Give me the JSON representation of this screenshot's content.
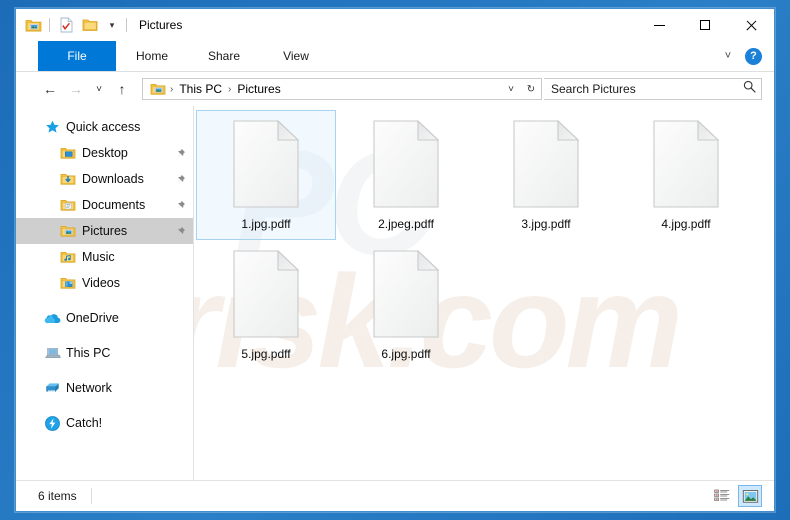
{
  "window": {
    "title": "Pictures",
    "quick_access_toolbar": [
      {
        "name": "pictures-folder-icon",
        "label": "Pictures properties"
      },
      {
        "name": "properties-icon",
        "label": "Properties"
      },
      {
        "name": "new-folder-icon",
        "label": "New folder"
      },
      {
        "name": "customize-qat-caret",
        "label": "▾"
      }
    ],
    "controls": {
      "minimize": "Minimize",
      "maximize": "Maximize",
      "close": "Close"
    }
  },
  "ribbon": {
    "tabs": [
      {
        "label": "File",
        "active": true
      },
      {
        "label": "Home",
        "active": false
      },
      {
        "label": "Share",
        "active": false
      },
      {
        "label": "View",
        "active": false
      }
    ],
    "expand_caret": "⌄",
    "help_label": "?"
  },
  "navigation": {
    "back": "←",
    "forward": "→",
    "recent": "⌄",
    "up": "↑",
    "breadcrumb": [
      "This PC",
      "Pictures"
    ],
    "breadcrumb_separator": "›",
    "dropdown_caret": "⌄",
    "refresh": "↻"
  },
  "search": {
    "placeholder": "Search Pictures",
    "value": "",
    "icon": "search-icon"
  },
  "sidebar": {
    "items": [
      {
        "label": "Quick access",
        "icon": "star-icon",
        "level": 0,
        "pinned": false,
        "selected": false
      },
      {
        "label": "Desktop",
        "icon": "desktop-folder-icon",
        "level": 1,
        "pinned": true,
        "selected": false
      },
      {
        "label": "Downloads",
        "icon": "downloads-folder-icon",
        "level": 1,
        "pinned": true,
        "selected": false
      },
      {
        "label": "Documents",
        "icon": "documents-folder-icon",
        "level": 1,
        "pinned": true,
        "selected": false
      },
      {
        "label": "Pictures",
        "icon": "pictures-folder-icon",
        "level": 1,
        "pinned": true,
        "selected": true
      },
      {
        "label": "Music",
        "icon": "music-folder-icon",
        "level": 1,
        "pinned": false,
        "selected": false
      },
      {
        "label": "Videos",
        "icon": "videos-folder-icon",
        "level": 1,
        "pinned": false,
        "selected": false
      },
      {
        "label": "OneDrive",
        "icon": "onedrive-cloud-icon",
        "level": 0,
        "pinned": false,
        "selected": false,
        "gap_before": true
      },
      {
        "label": "This PC",
        "icon": "this-pc-icon",
        "level": 0,
        "pinned": false,
        "selected": false,
        "gap_before": true
      },
      {
        "label": "Network",
        "icon": "network-icon",
        "level": 0,
        "pinned": false,
        "selected": false,
        "gap_before": true
      },
      {
        "label": "Catch!",
        "icon": "catch-lightning-icon",
        "level": 0,
        "pinned": false,
        "selected": false,
        "gap_before": true
      }
    ]
  },
  "files": [
    {
      "name": "1.jpg.pdff",
      "icon": "blank-document-icon",
      "selected": true
    },
    {
      "name": "2.jpeg.pdff",
      "icon": "blank-document-icon",
      "selected": false
    },
    {
      "name": "3.jpg.pdff",
      "icon": "blank-document-icon",
      "selected": false
    },
    {
      "name": "4.jpg.pdff",
      "icon": "blank-document-icon",
      "selected": false
    },
    {
      "name": "5.jpg.pdff",
      "icon": "blank-document-icon",
      "selected": false
    },
    {
      "name": "6.jpg.pdff",
      "icon": "blank-document-icon",
      "selected": false
    }
  ],
  "status": {
    "item_count": "6 items",
    "views": [
      {
        "name": "details-view-button",
        "label": "Details view",
        "active": false
      },
      {
        "name": "large-icons-view-button",
        "label": "Large icons view",
        "active": true
      }
    ]
  },
  "watermark": {
    "line1": "PC",
    "line2": "risk.com"
  },
  "colors": {
    "accent": "#0078d7",
    "desktop": "#1d6eb9",
    "selection": "#cde8ff",
    "nav_selected": "#cfcfcf"
  }
}
